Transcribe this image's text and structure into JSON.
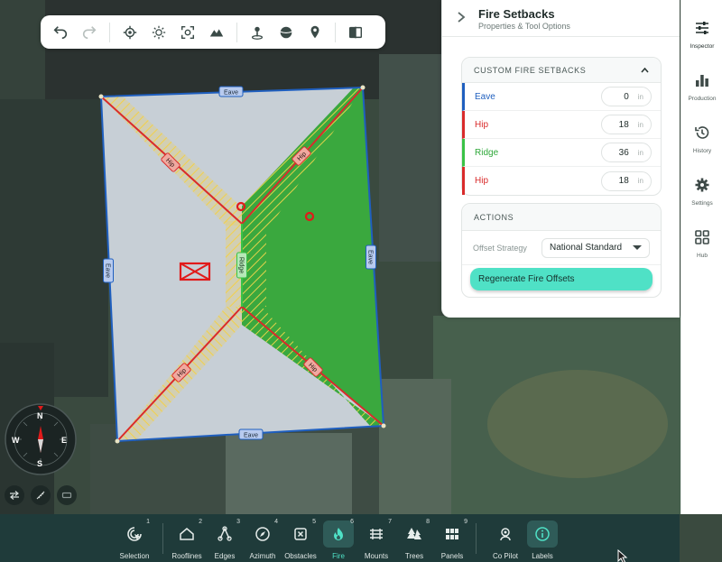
{
  "colors": {
    "accent": "#4fe1c6",
    "eave_blue": "#1f5fbf",
    "hip_red": "#d92b2b",
    "ridge_green": "#3ac246",
    "roof_green": "#3aa83e",
    "setback_yellow": "#f2d04a",
    "bottom_bar": "#1f3b3a"
  },
  "map": {
    "edge_labels": {
      "eave_top": "Eave",
      "eave_left": "Eave",
      "eave_right": "Eave",
      "eave_bottom": "Eave",
      "hip_tl": "Hip",
      "hip_tr": "Hip",
      "hip_bl": "Hip",
      "hip_br": "Hip",
      "ridge": "Ridge"
    }
  },
  "toolbar": {
    "icons": [
      "undo-icon",
      "redo-icon",
      "locate-icon",
      "brightness-icon",
      "focus-icon",
      "terrain-icon",
      "pin-icon",
      "globe-icon",
      "pin-off-icon",
      "split-view-icon"
    ]
  },
  "panel": {
    "title": "Fire Setbacks",
    "subtitle": "Properties & Tool Options",
    "custom_section": {
      "heading": "CUSTOM FIRE SETBACKS",
      "rows": [
        {
          "label": "Eave",
          "value": "0",
          "unit": "in",
          "color": "#1f5fbf"
        },
        {
          "label": "Hip",
          "value": "18",
          "unit": "in",
          "color": "#d92b2b"
        },
        {
          "label": "Ridge",
          "value": "36",
          "unit": "in",
          "color": "#3ac246"
        },
        {
          "label": "Hip",
          "value": "18",
          "unit": "in",
          "color": "#d92b2b"
        }
      ]
    },
    "actions": {
      "heading": "ACTIONS",
      "offset_label": "Offset Strategy",
      "offset_value": "National Standard",
      "regen_label": "Regenerate Fire Offsets"
    }
  },
  "rail": {
    "items": [
      {
        "label": "Inspector",
        "icon": "sliders-icon"
      },
      {
        "label": "Production",
        "icon": "bar-chart-icon"
      },
      {
        "label": "History",
        "icon": "history-icon"
      },
      {
        "label": "Settings",
        "icon": "gear-icon"
      },
      {
        "label": "Hub",
        "icon": "grid-icon"
      }
    ]
  },
  "compass": {
    "n": "N",
    "s": "S",
    "e": "E",
    "w": "W"
  },
  "bottombar": {
    "items": [
      {
        "label": "Selection",
        "num": "1",
        "icon": "selection-icon"
      },
      {
        "label": "Rooflines",
        "num": "2",
        "icon": "roofline-icon"
      },
      {
        "label": "Edges",
        "num": "3",
        "icon": "edges-icon"
      },
      {
        "label": "Azimuth",
        "num": "4",
        "icon": "compass-icon"
      },
      {
        "label": "Obstacles",
        "num": "5",
        "icon": "obstacle-icon"
      },
      {
        "label": "Fire",
        "num": "6",
        "icon": "fire-icon"
      },
      {
        "label": "Mounts",
        "num": "7",
        "icon": "mounts-icon"
      },
      {
        "label": "Trees",
        "num": "8",
        "icon": "trees-icon"
      },
      {
        "label": "Panels",
        "num": "9",
        "icon": "panels-icon"
      },
      {
        "label": "Co Pilot",
        "num": "",
        "icon": "copilot-icon"
      },
      {
        "label": "Labels",
        "num": "",
        "icon": "info-icon"
      }
    ]
  }
}
